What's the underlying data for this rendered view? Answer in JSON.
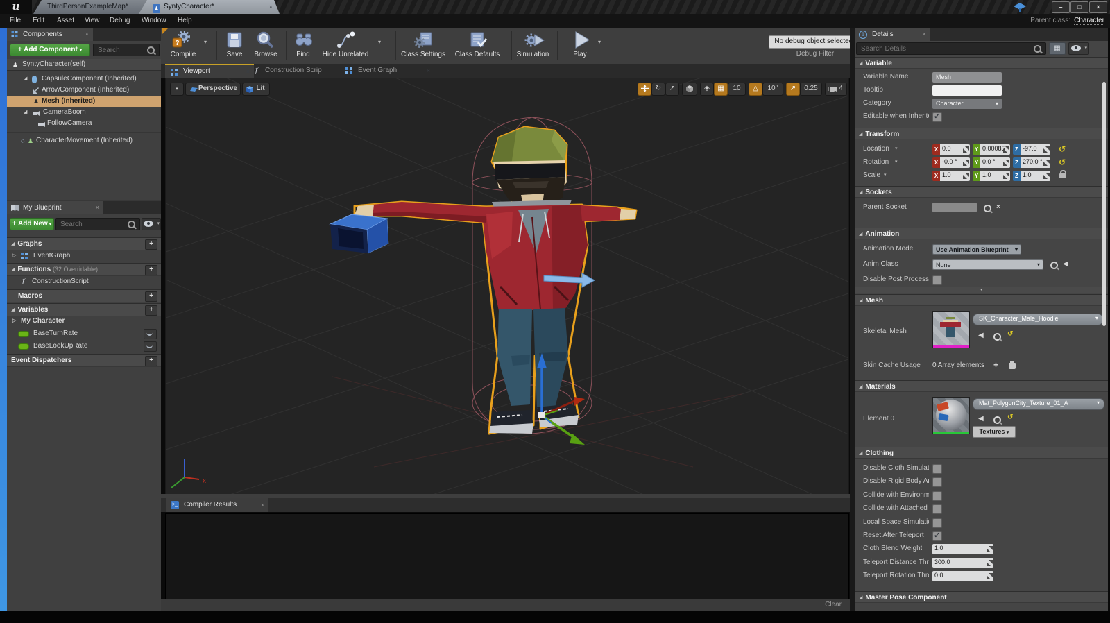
{
  "icons": {
    "close": "×",
    "dropdown": "▾",
    "expand": "▷",
    "section": "◢",
    "plus": "+",
    "back": "◀",
    "reset": "↺",
    "rotate": "↻",
    "scale_arrow": "↗",
    "grid": "▦",
    "angle": "△",
    "surface": "◈",
    "person": "♟",
    "diamond": "◇",
    "minimize": "–",
    "maximize": "□",
    "f": "f"
  },
  "chrome": {
    "logo": "u",
    "tabs": [
      {
        "label": "ThirdPersonExampleMap*"
      },
      {
        "label": "SyntyCharacter*"
      }
    ],
    "menus": [
      "File",
      "Edit",
      "Asset",
      "View",
      "Debug",
      "Window",
      "Help"
    ],
    "parent_class_label": "Parent class:",
    "parent_class_value": "Character"
  },
  "components": {
    "title": "Components",
    "add_button": "+ Add Component",
    "search_placeholder": "Search",
    "items": [
      "SyntyCharacter(self)",
      "CapsuleComponent (Inherited)",
      "ArrowComponent (Inherited)",
      "Mesh (Inherited)",
      "CameraBoom",
      "FollowCamera",
      "CharacterMovement (Inherited)"
    ]
  },
  "my_blueprint": {
    "title": "My Blueprint",
    "add_button": "+ Add New",
    "search_placeholder": "Search",
    "graphs_label": "Graphs",
    "eventgraph_label": "EventGraph",
    "functions_label": "Functions",
    "functions_note": "(32 Overridable)",
    "construction_script_label": "ConstructionScript",
    "macros_label": "Macros",
    "variables_label": "Variables",
    "my_character_label": "My Character",
    "variables": [
      "BaseTurnRate",
      "BaseLookUpRate"
    ],
    "event_dispatchers_label": "Event Dispatchers"
  },
  "toolbar": {
    "compile": "Compile",
    "save": "Save",
    "browse": "Browse",
    "find": "Find",
    "hide_unrelated": "Hide Unrelated",
    "class_settings": "Class Settings",
    "class_defaults": "Class Defaults",
    "simulation": "Simulation",
    "play": "Play",
    "debug_dropdown": "No debug object selected",
    "debug_filter_label": "Debug Filter"
  },
  "viewport": {
    "tabs": [
      "Viewport",
      "Construction Scrip",
      "Event Graph"
    ],
    "perspective": "Perspective",
    "lit": "Lit",
    "grid_snap": "10",
    "rotation_snap": "10°",
    "scale_snap": "0.25",
    "camera_speed": "4",
    "axis_x": "x"
  },
  "compiler": {
    "title": "Compiler Results",
    "clear": "Clear"
  },
  "details": {
    "title": "Details",
    "search_placeholder": "Search Details",
    "variable": {
      "header": "Variable",
      "name_label": "Variable Name",
      "name_value": "Mesh",
      "tooltip_label": "Tooltip",
      "tooltip_value": "",
      "category_label": "Category",
      "category_value": "Character",
      "editable_label": "Editable when Inherited",
      "editable_checked": true
    },
    "transform": {
      "header": "Transform",
      "location_label": "Location",
      "rotation_label": "Rotation",
      "scale_label": "Scale",
      "location": {
        "x": "0.0",
        "y": "0.00085",
        "z": "-97.0"
      },
      "rotation": {
        "x": "-0.0 °",
        "y": "0.0 °",
        "z": "270.0 °"
      },
      "scale": {
        "x": "1.0",
        "y": "1.0",
        "z": "1.0"
      }
    },
    "sockets": {
      "header": "Sockets",
      "parent_socket_label": "Parent Socket"
    },
    "animation": {
      "header": "Animation",
      "mode_label": "Animation Mode",
      "mode_value": "Use Animation Blueprint",
      "anim_class_label": "Anim Class",
      "anim_class_value": "None",
      "disable_pp_label": "Disable Post Process Bl",
      "disable_pp_checked": false
    },
    "mesh": {
      "header": "Mesh",
      "skeletal_label": "Skeletal Mesh",
      "skeletal_value": "SK_Character_Male_Hoodie",
      "skin_cache_label": "Skin Cache Usage",
      "skin_cache_value": "0 Array elements"
    },
    "materials": {
      "header": "Materials",
      "element_label": "Element 0",
      "element_value": "Mat_PolygonCity_Texture_01_A",
      "textures_button": "Textures"
    },
    "clothing": {
      "header": "Clothing",
      "checkboxes": [
        "Disable Cloth Simulation",
        "Disable Rigid Body Anim",
        "Collide with Environmen",
        "Collide with Attached Ch",
        "Local Space Simulation",
        "Reset After Teleport"
      ],
      "states": [
        false,
        false,
        false,
        false,
        false,
        true
      ],
      "cloth_blend_label": "Cloth Blend Weight",
      "cloth_blend_value": "1.0",
      "teleport_dist_label": "Teleport Distance Thres",
      "teleport_dist_value": "300.0",
      "teleport_rot_label": "Teleport Rotation Thres",
      "teleport_rot_value": "0.0"
    },
    "master_pose": {
      "header": "Master Pose Component"
    }
  },
  "colors": {
    "accent_orange": "#b5791e",
    "selection_tan": "#cfa36f",
    "x_red": "#9e2b1f",
    "y_green": "#5f9a1a",
    "z_blue": "#2e6da4",
    "add_green": "#4a9e3f",
    "outline_orange": "#e8a01c"
  }
}
